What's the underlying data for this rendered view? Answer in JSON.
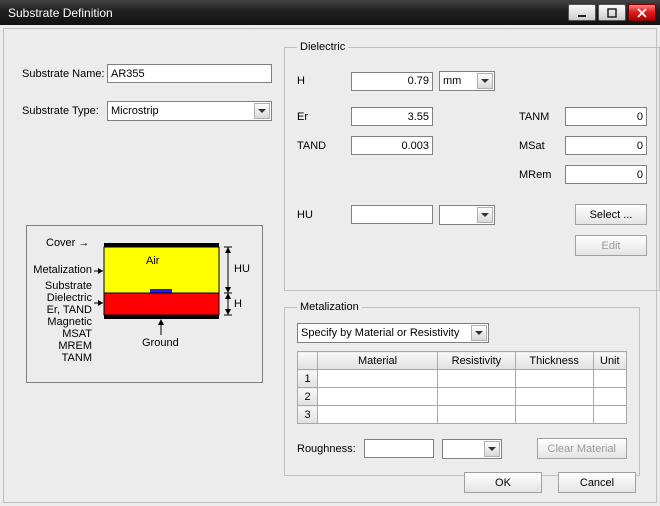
{
  "window": {
    "title": "Substrate Definition"
  },
  "substrate": {
    "name_label": "Substrate Name:",
    "name_value": "AR355",
    "type_label": "Substrate Type:",
    "type_value": "Microstrip"
  },
  "diagram": {
    "cover": "Cover",
    "metalization": "Metalization",
    "substrate": "Substrate",
    "dielectric": "Dielectric",
    "ertand": "Er, TAND",
    "magnetic": "Magnetic",
    "msat": "MSAT",
    "mrem": "MREM",
    "tanm": "TANM",
    "air": "Air",
    "ground": "Ground",
    "HU": "HU",
    "H": "H"
  },
  "dielectric": {
    "legend": "Dielectric",
    "H_label": "H",
    "H_value": "0.79",
    "H_unit": "mm",
    "Er_label": "Er",
    "Er_value": "3.55",
    "TANM_label": "TANM",
    "TANM_value": "0",
    "TAND_label": "TAND",
    "TAND_value": "0.003",
    "MSat_label": "MSat",
    "MSat_value": "0",
    "MRem_label": "MRem",
    "MRem_value": "0",
    "HU_label": "HU",
    "HU_value": "",
    "HU_unit": "",
    "select_btn": "Select ...",
    "edit_btn": "Edit"
  },
  "metalization": {
    "legend": "Metalization",
    "mode": "Specify by Material or Resistivity",
    "cols": {
      "material": "Material",
      "resistivity": "Resistivity",
      "thickness": "Thickness",
      "unit": "Unit"
    },
    "rows": [
      {
        "n": "1",
        "material": "",
        "resistivity": "",
        "thickness": "",
        "unit": ""
      },
      {
        "n": "2",
        "material": "",
        "resistivity": "",
        "thickness": "",
        "unit": ""
      },
      {
        "n": "3",
        "material": "",
        "resistivity": "",
        "thickness": "",
        "unit": ""
      }
    ],
    "roughness_label": "Roughness:",
    "roughness_value": "",
    "roughness_unit": "",
    "clear_btn": "Clear Material"
  },
  "buttons": {
    "ok": "OK",
    "cancel": "Cancel"
  }
}
